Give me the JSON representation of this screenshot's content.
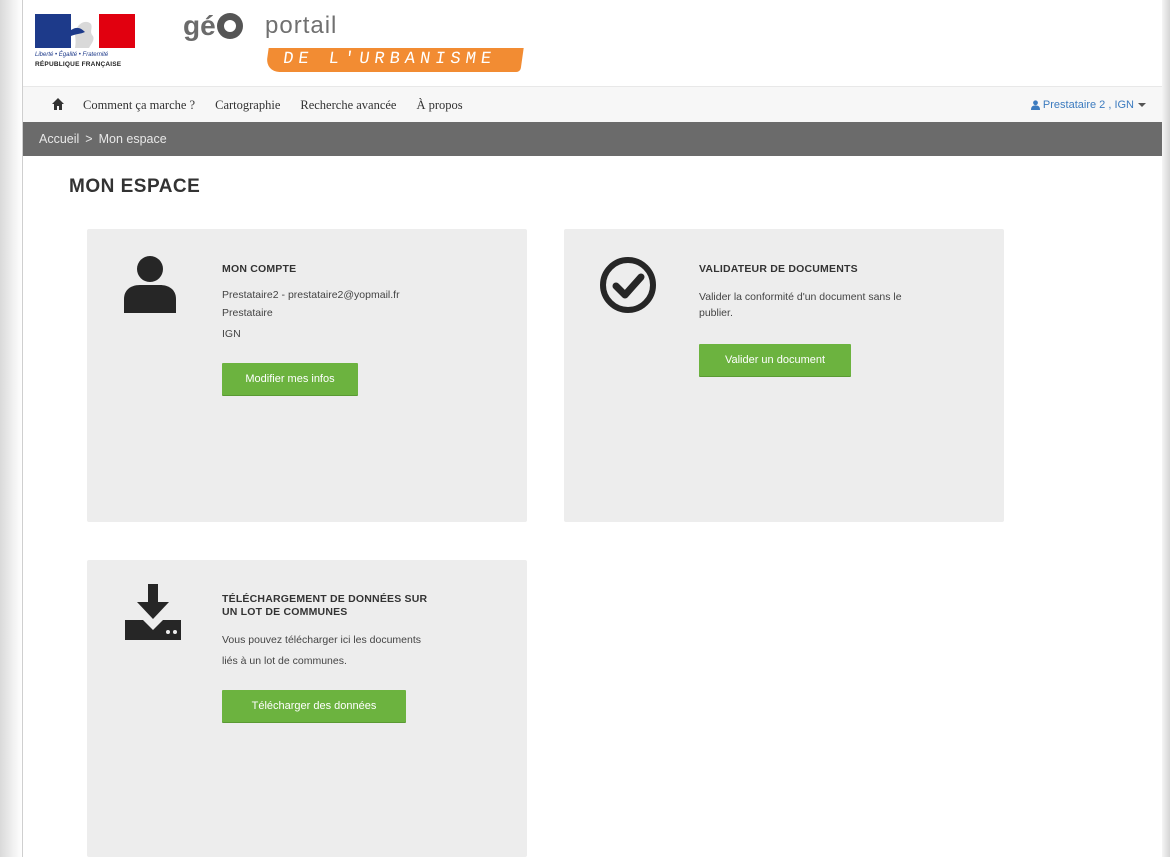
{
  "header": {
    "marianne_devise": "Liberté • Égalité • Fraternité",
    "marianne_republique": "RÉPUBLIQUE FRANÇAISE",
    "logo_ge": "gé",
    "logo_portail": "portail",
    "logo_urbanisme": "DE L'URBANISME"
  },
  "nav": {
    "home_icon": "home-icon",
    "items": [
      "Comment ça marche ?",
      "Cartographie",
      "Recherche avancée",
      "À propos"
    ],
    "user_label": "Prestataire 2 , IGN",
    "user_icon": "user-icon"
  },
  "breadcrumb": {
    "home": "Accueil",
    "separator": ">",
    "current": "Mon espace"
  },
  "page_title": "MON ESPACE",
  "cards": {
    "account": {
      "icon": "user-silhouette-icon",
      "title": "MON COMPTE",
      "line1": "Prestataire2 - prestataire2@yopmail.fr",
      "line2": "Prestataire",
      "line3": "IGN",
      "button": "Modifier mes infos"
    },
    "validator": {
      "icon": "check-circle-icon",
      "title": "VALIDATEUR DE DOCUMENTS",
      "line1": "Valider la conformité d'un document sans le",
      "line2": "publier.",
      "button": "Valider un document"
    },
    "download": {
      "icon": "download-icon",
      "title_line1": "TÉLÉCHARGEMENT DE DONNÉES SUR",
      "title_line2": "UN LOT DE COMMUNES",
      "line1": "Vous pouvez télécharger ici les documents",
      "line2": "liés à un lot de communes.",
      "button": "Télécharger des données"
    }
  },
  "colors": {
    "button_green": "#6cb33f",
    "breadcrumb_bg": "#6b6b6b",
    "card_bg": "#ededed",
    "user_link": "#3c7bbf",
    "logo_orange": "#f28c33"
  }
}
